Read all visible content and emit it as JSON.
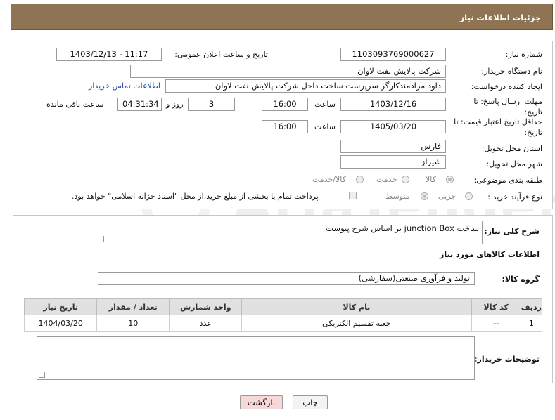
{
  "header": {
    "title": "جزئیات اطلاعات نیاز"
  },
  "form": {
    "need_number_label": "شماره نیاز:",
    "need_number": "1103093769000627",
    "announce_label": "تاریخ و ساعت اعلان عمومی:",
    "announce_value": "1403/12/13 - 11:17",
    "buyer_org_label": "نام دستگاه خریدار:",
    "buyer_org": "شرکت پالایش نفت لاوان",
    "creator_label": "ایجاد کننده درخواست:",
    "creator": "داود مرادمندکارگر سرپرست ساخت داخل شرکت پالایش نفت لاوان",
    "contact_link": "اطلاعات تماس خریدار",
    "deadline_label_1": "مهلت ارسال پاسخ: تا",
    "deadline_label_2": "تاریخ:",
    "deadline_date": "1403/12/16",
    "time_word": "ساعت",
    "deadline_time": "16:00",
    "days_value": "3",
    "days_label": "روز و",
    "remaining_time": "04:31:34",
    "remaining_label": "ساعت باقی مانده",
    "min_validity_label_1": "حداقل تاریخ اعتبار قیمت: تا",
    "min_validity_label_2": "تاریخ:",
    "validity_date": "1405/03/20",
    "validity_time": "16:00",
    "province_label": "استان محل تحویل:",
    "province": "فارس",
    "city_label": "شهر محل تحویل:",
    "city": "شیراز",
    "category_label": "طبقه بندی موضوعی:",
    "category_options": [
      "کالا",
      "خدمت",
      "کالا/خدمت"
    ],
    "process_label": "نوع فرآیند خرید :",
    "process_options": [
      "جزیی",
      "متوسط"
    ],
    "payment_note": "پرداخت تمام یا بخشی از مبلغ خرید،از محل \"اسناد خزانه اسلامی\" خواهد بود."
  },
  "description": {
    "label": "شرح کلی نیاز:",
    "value": "ساخت junction Box بر اساس شرح پیوست"
  },
  "goods_section": {
    "title": "اطلاعات کالاهای مورد نیاز",
    "group_label": "گروه کالا:",
    "group_value": "تولید و فرآوری صنعتی(سفارشی)"
  },
  "items_table": {
    "headers": [
      "ردیف",
      "کد کالا",
      "نام کالا",
      "واحد شمارش",
      "تعداد / مقدار",
      "تاریخ نیاز"
    ],
    "rows": [
      [
        "1",
        "--",
        "جعبه تقسیم الکتریکی",
        "عدد",
        "10",
        "1404/03/20"
      ]
    ]
  },
  "buyer_notes": {
    "label": "توضیحات خریدار:",
    "value": ""
  },
  "buttons": {
    "print": "چاپ",
    "back": "بازگشت"
  },
  "colors": {
    "header": "#8e7452",
    "back_button": "#f7d8d8",
    "link": "#2a4fb5"
  }
}
